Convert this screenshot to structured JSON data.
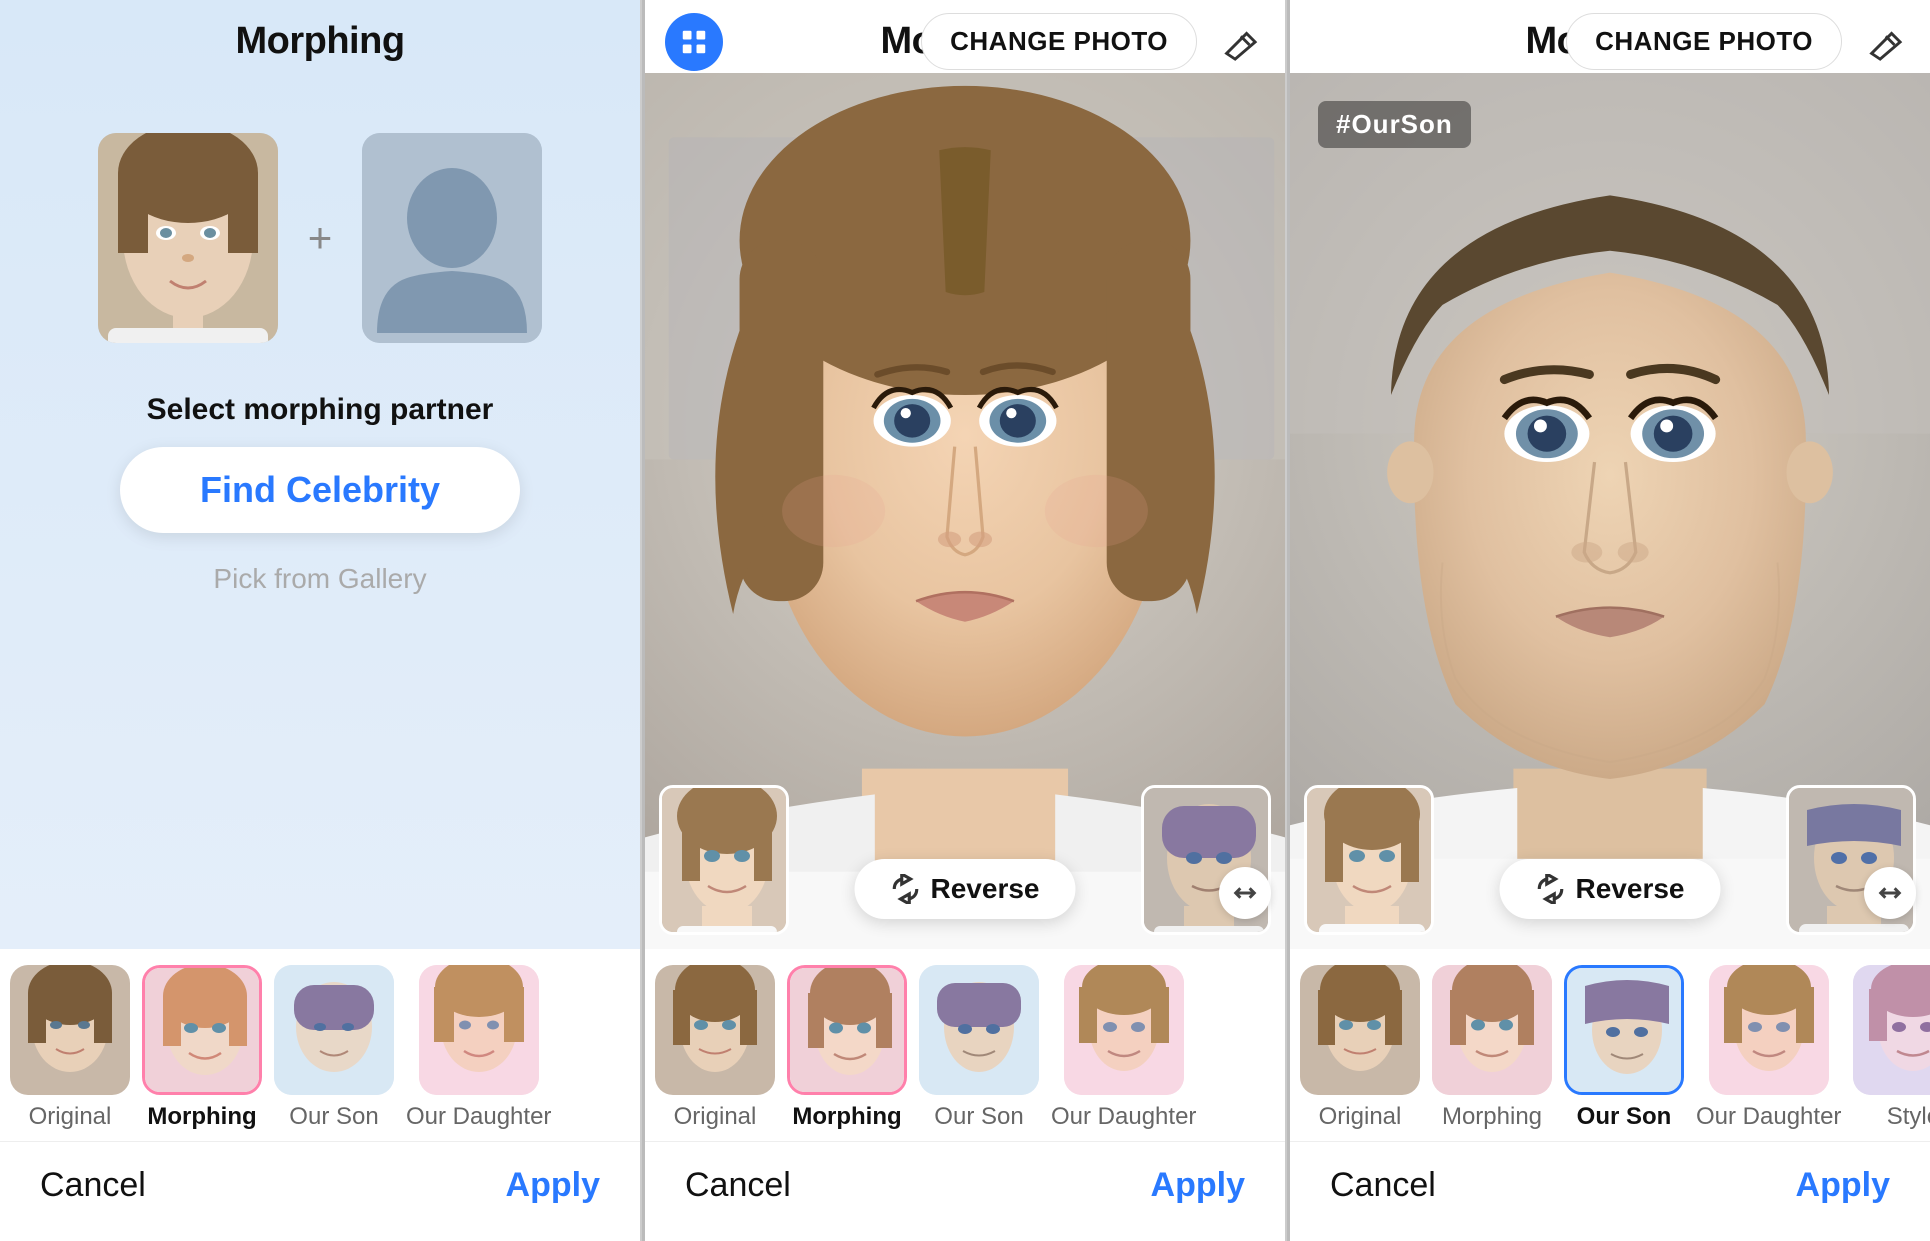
{
  "screens": [
    {
      "id": "screen1",
      "title": "Morphing",
      "partnerLabel": "Select morphing partner",
      "findCelebrityBtn": "Find Celebrity",
      "pickGalleryBtn": "Pick from Gallery",
      "cancelBtn": "Cancel",
      "applyBtn": "Apply",
      "tabs": [
        {
          "label": "Original",
          "active": false
        },
        {
          "label": "Morphing",
          "active": true
        },
        {
          "label": "Our Son",
          "active": false
        },
        {
          "label": "Our Daughter",
          "active": false
        }
      ]
    },
    {
      "id": "screen2",
      "title": "Morphing",
      "changePhotoBtn": "CHANGE PHOTO",
      "reverseBtn": "Reverse",
      "cancelBtn": "Cancel",
      "applyBtn": "Apply",
      "tabs": [
        {
          "label": "Original",
          "active": false
        },
        {
          "label": "Morphing",
          "active": true
        },
        {
          "label": "Our Son",
          "active": false
        },
        {
          "label": "Our Daughter",
          "active": false
        }
      ]
    },
    {
      "id": "screen3",
      "title": "Morphing",
      "changePhotoBtn": "CHANGE PHOTO",
      "watermark": "#OurSon",
      "reverseBtn": "Reverse",
      "cancelBtn": "Cancel",
      "applyBtn": "Apply",
      "tabs": [
        {
          "label": "Original",
          "active": false
        },
        {
          "label": "Morphing",
          "active": false
        },
        {
          "label": "Our Son",
          "active": true
        },
        {
          "label": "Our Daughter",
          "active": false
        },
        {
          "label": "Style",
          "active": false
        }
      ]
    }
  ],
  "icons": {
    "grid": "⊞",
    "eraser": "◇",
    "reverse": "↻",
    "expand": "⟷"
  }
}
